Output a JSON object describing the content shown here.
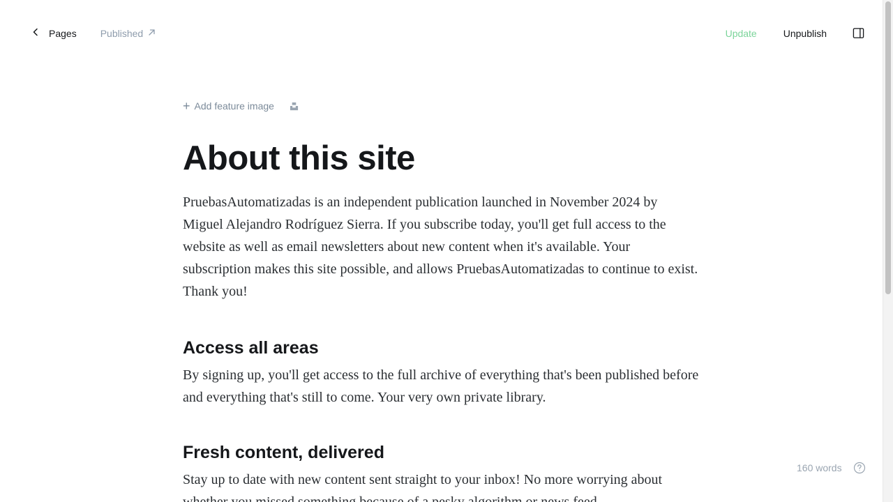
{
  "topbar": {
    "back_label": "Pages",
    "status_label": "Published",
    "update_label": "Update",
    "unpublish_label": "Unpublish"
  },
  "editor": {
    "add_feature_image_label": "Add feature image",
    "title": "About this site",
    "intro": "PruebasAutomatizadas is an independent publication launched in November 2024 by Miguel Alejandro Rodríguez Sierra. If you subscribe today, you'll get full access to the website as well as email newsletters about new content when it's available. Your subscription makes this site possible, and allows PruebasAutomatizadas to continue to exist. Thank you!",
    "sections": [
      {
        "heading": "Access all areas",
        "body": "By signing up, you'll get access to the full archive of everything that's been published before and everything that's still to come. Your very own private library."
      },
      {
        "heading": "Fresh content, delivered",
        "body": "Stay up to date with new content sent straight to your inbox! No more worrying about whether you missed something because of a pesky algorithm or news feed."
      }
    ]
  },
  "footer": {
    "word_count": "160 words"
  },
  "colors": {
    "accent_green": "#7bd49a",
    "muted_text": "#8e9cac",
    "primary_text": "#15171a"
  },
  "icons": {
    "back": "chevron-left-icon",
    "status": "arrow-up-right-icon",
    "sidebar": "sidebar-panel-icon",
    "unsplash": "unsplash-icon",
    "help": "question-circle-icon"
  }
}
